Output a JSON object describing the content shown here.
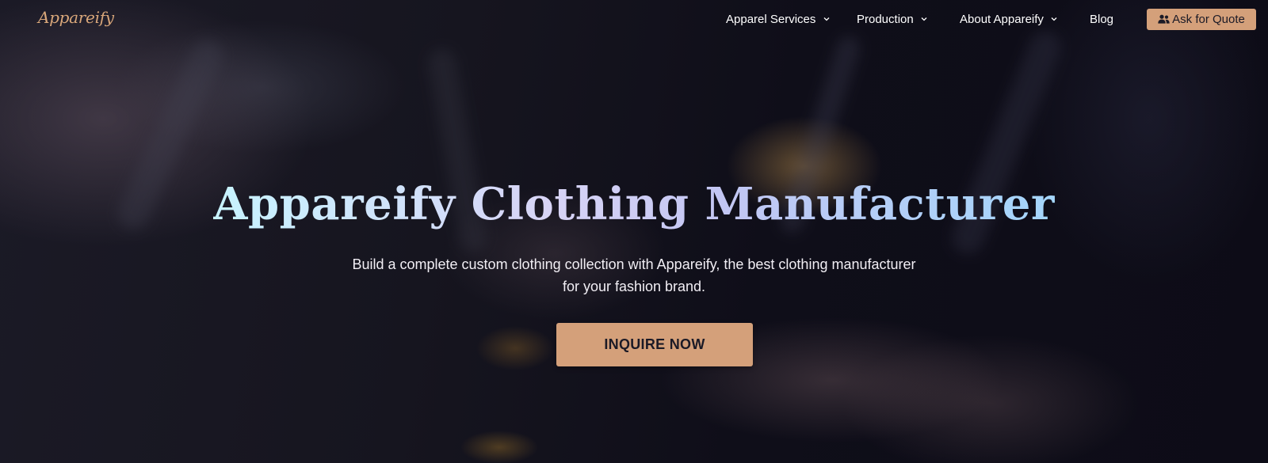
{
  "brand": {
    "logo_text": "Appareify",
    "accent_color": "#d4a07a"
  },
  "nav": {
    "items": [
      {
        "label": "Apparel Services",
        "has_dropdown": true,
        "icon": "chevron-down-icon"
      },
      {
        "label": "Production",
        "has_dropdown": true,
        "icon": "chevron-down-icon"
      },
      {
        "label": "About Appareify",
        "has_dropdown": true,
        "icon": "chevron-down-icon"
      },
      {
        "label": "Blog",
        "has_dropdown": false
      }
    ],
    "quote_button": {
      "label": "Ask for Quote",
      "icon": "users-icon"
    }
  },
  "hero": {
    "title": "Appareify Clothing Manufacturer",
    "subtitle": "Build a complete custom clothing collection with Appareify, the best clothing manufacturer for your fashion brand.",
    "cta_label": "INQUIRE NOW"
  }
}
